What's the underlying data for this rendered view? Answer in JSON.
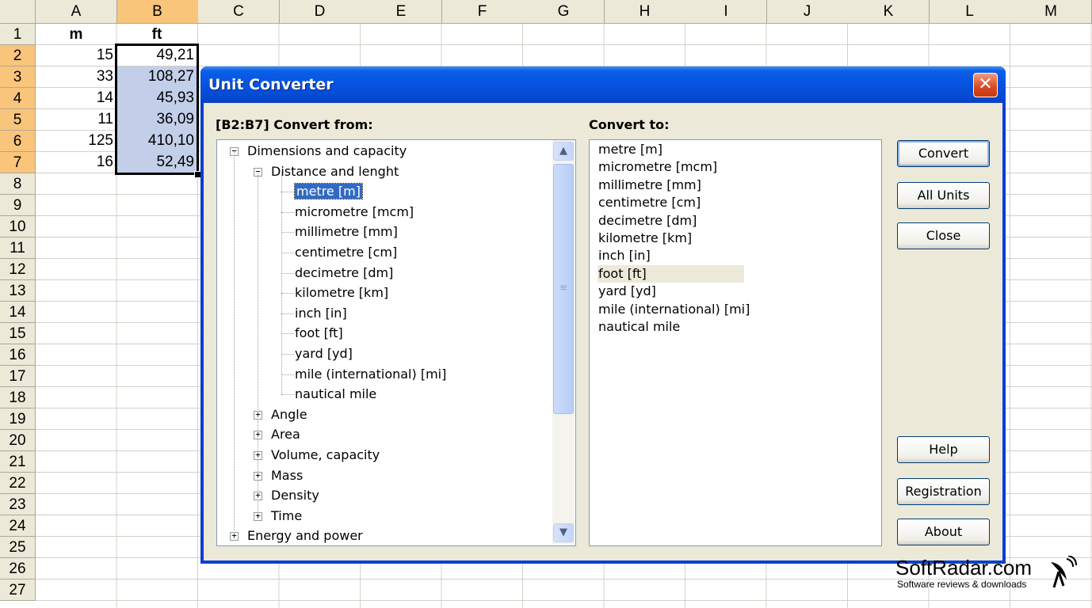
{
  "sheet": {
    "columns": [
      "A",
      "B",
      "C",
      "D",
      "E",
      "F",
      "G",
      "H",
      "I",
      "J",
      "K",
      "L",
      "M"
    ],
    "rows": [
      "1",
      "2",
      "3",
      "4",
      "5",
      "6",
      "7",
      "8",
      "9",
      "10",
      "11",
      "12",
      "13",
      "14",
      "15",
      "16",
      "17",
      "18",
      "19",
      "20",
      "21",
      "22",
      "23",
      "24",
      "25",
      "26",
      "27"
    ],
    "headers": {
      "a": "m",
      "b": "ft"
    },
    "data": [
      {
        "a": "15",
        "b": "49,21"
      },
      {
        "a": "33",
        "b": "108,27"
      },
      {
        "a": "14",
        "b": "45,93"
      },
      {
        "a": "11",
        "b": "36,09"
      },
      {
        "a": "125",
        "b": "410,10"
      },
      {
        "a": "16",
        "b": "52,49"
      }
    ]
  },
  "dialog": {
    "title": "Unit Converter",
    "from_label": "[B2:B7] Convert from:",
    "to_label": "Convert to:",
    "tree": {
      "root": "Dimensions and capacity",
      "group": "Distance and lenght",
      "units": [
        "metre [m]",
        "micrometre [mcm]",
        "millimetre [mm]",
        "centimetre [cm]",
        "decimetre [dm]",
        "kilometre [km]",
        "inch [in]",
        "foot [ft]",
        "yard [yd]",
        "mile (international) [mi]",
        "nautical mile"
      ],
      "collapsed": [
        "Angle",
        "Area",
        "Volume, capacity",
        "Mass",
        "Density",
        "Time"
      ],
      "other_root": "Energy and power"
    },
    "to_list": [
      "metre [m]",
      "micrometre [mcm]",
      "millimetre [mm]",
      "centimetre [cm]",
      "decimetre [dm]",
      "kilometre [km]",
      "inch [in]",
      "foot [ft]",
      "yard [yd]",
      "mile (international) [mi]",
      "nautical mile"
    ],
    "buttons": {
      "convert": "Convert",
      "all_units": "All Units",
      "close": "Close",
      "help": "Help",
      "registration": "Registration",
      "about": "About"
    },
    "close_glyph": "✕"
  },
  "watermark": {
    "brand": "SoftRadar.com",
    "tagline": "Software reviews & downloads"
  }
}
